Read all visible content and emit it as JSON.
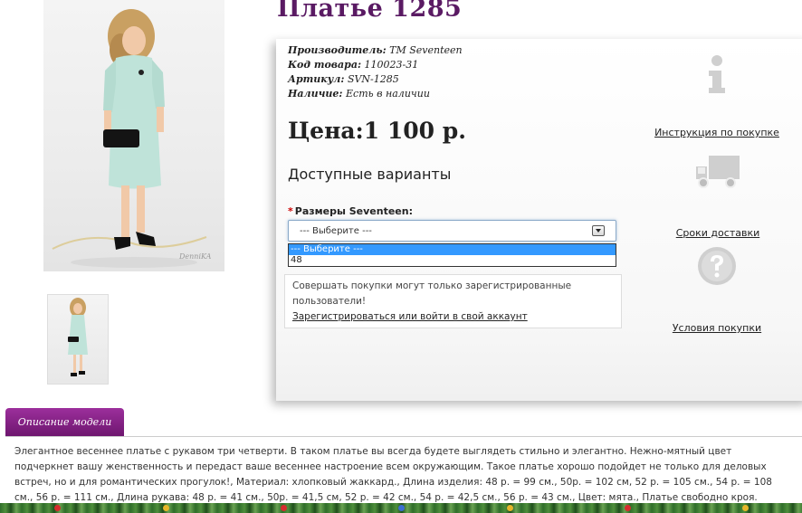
{
  "product": {
    "title": "Платье 1285",
    "specs": [
      {
        "label": "Производитель:",
        "value": "TM Seventeen"
      },
      {
        "label": "Код товара:",
        "value": "110023-31"
      },
      {
        "label": "Артикул:",
        "value": "SVN-1285"
      },
      {
        "label": "Наличие:",
        "value": "Есть в наличии"
      }
    ],
    "price": "Цена:1 100 р.",
    "variants_heading": "Доступные варианты",
    "option": {
      "required_mark": "*",
      "label": "Размеры Seventeen:",
      "selected": "--- Выберите ---",
      "options": [
        "--- Выберите ---",
        "48"
      ]
    },
    "notice": {
      "text": "Совершать покупки могут только зарегистрированные пользователи!",
      "link": "Зарегистрироваться или войти в свой аккаунт"
    },
    "photo_watermark": "DenniKA"
  },
  "sidebar": [
    {
      "icon": "info-icon",
      "label": "Инструкция по покупке"
    },
    {
      "icon": "truck-icon",
      "label": "Сроки доставки"
    },
    {
      "icon": "question-icon",
      "label": "Условия покупки"
    }
  ],
  "description": {
    "tab": "Описание модели",
    "text": "Элегантное весеннее платье с рукавом три четверти. В таком платье вы всегда будете выглядеть стильно и элегантно. Нежно-мятный цвет подчеркнет вашу женственность и передаст ваше весеннее настроение всем окружающим. Такое платье хорошо подойдет не только для деловых встреч, но и для романтических прогулок!, Материал: хлопковый жаккард., Длина изделия: 48 р. = 99 см., 50р. = 102 см, 52 р. = 105 см., 54 р. = 108 см., 56 р. = 111 см., Длина рукава: 48 р. = 41 см., 50р. = 41,5 см, 52 р. = 42 см., 54 р. = 42,5 см., 56 р. = 43 см., Цвет: мята., Платье свободно кроя."
  },
  "colors": {
    "title": "#5a1a63",
    "tab": "#7d1f80",
    "select_highlight": "#3399ff",
    "dress": "#bfe3d9"
  }
}
